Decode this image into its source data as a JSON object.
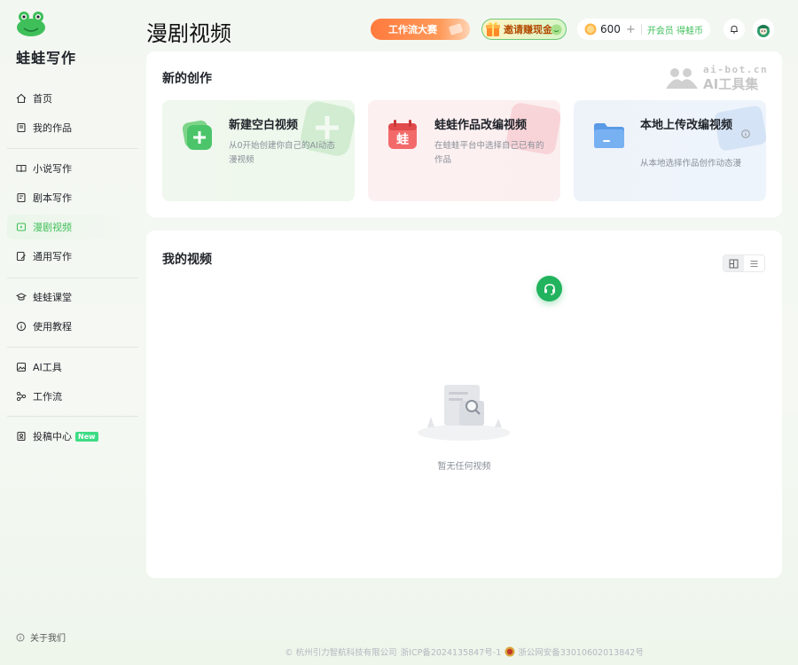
{
  "app": {
    "name": "蛙蛙写作"
  },
  "sidebar": {
    "groups": [
      [
        {
          "label": "首页",
          "icon": "home-icon"
        },
        {
          "label": "我的作品",
          "icon": "book-icon"
        }
      ],
      [
        {
          "label": "小说写作",
          "icon": "open-book-icon"
        },
        {
          "label": "剧本写作",
          "icon": "script-icon"
        },
        {
          "label": "漫剧视频",
          "icon": "video-icon",
          "active": true
        },
        {
          "label": "通用写作",
          "icon": "edit-doc-icon"
        }
      ],
      [
        {
          "label": "蛙蛙课堂",
          "icon": "graduation-cap-icon"
        },
        {
          "label": "使用教程",
          "icon": "info-circle-icon"
        }
      ],
      [
        {
          "label": "AI工具",
          "icon": "image-tool-icon"
        },
        {
          "label": "工作流",
          "icon": "workflow-icon"
        }
      ],
      [
        {
          "label": "投稿中心",
          "icon": "submit-icon",
          "badge": "New"
        }
      ]
    ],
    "about": "关于我们"
  },
  "header": {
    "title": "漫剧视频",
    "workflow_contest": "工作流大赛",
    "invite_cash": "邀请赚现金",
    "coins": "600",
    "coins_plus": "+",
    "member_link": "开会员 得蛙币"
  },
  "watermark": {
    "url": "ai-bot.cn",
    "name": "AI工具集"
  },
  "new_creation": {
    "title": "新的创作",
    "options": [
      {
        "title": "新建空白视频",
        "desc": "从0开始创建你自己的AI动态漫视频"
      },
      {
        "title": "蛙蛙作品改编视频",
        "desc": "在蛙蛙平台中选择自己已有的作品",
        "icon_char": "蛙"
      },
      {
        "title": "本地上传改编视频",
        "desc": "从本地选择作品创作动态漫"
      }
    ]
  },
  "my_videos": {
    "title": "我的视频",
    "empty_text": "暂无任何视频"
  },
  "footer": {
    "company": "© 杭州引力智航科技有限公司",
    "icp": "浙ICP备2024135847号-1",
    "police": "浙公网安备33010602013842号"
  },
  "colors": {
    "brand_green": "#3fbf5a",
    "workflow_orange": "#ff7a3d",
    "support_green": "#22b35e"
  }
}
